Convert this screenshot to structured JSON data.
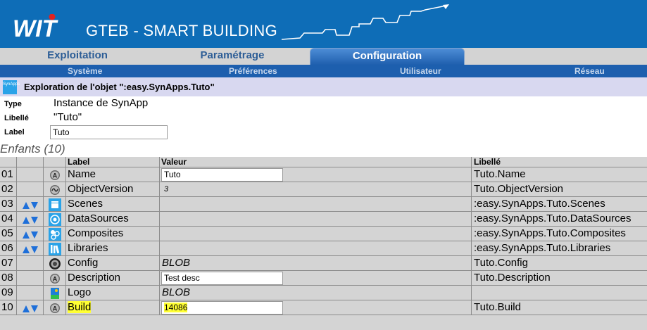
{
  "header": {
    "logo_text": "WIT",
    "app_title": "GTEB - SMART BUILDING",
    "colors": {
      "header_bg": "#0e6db7",
      "logo_red": "#e2221f",
      "accent_blue": "#1d5fae"
    }
  },
  "tabs": [
    {
      "label": "Exploitation",
      "active": false
    },
    {
      "label": "Paramétrage",
      "active": false
    },
    {
      "label": "Configuration",
      "active": true
    }
  ],
  "subtabs": [
    {
      "label": "Système"
    },
    {
      "label": "Préférences"
    },
    {
      "label": "Utilisateur"
    },
    {
      "label": "Réseau"
    }
  ],
  "explorer": {
    "icon_text": "SynApps",
    "title": "Exploration de l'objet \":easy.SynApps.Tuto\"",
    "type_label": "Type",
    "type_value": "Instance de SynApp",
    "libelle_label": "Libellé",
    "libelle_value": "\"Tuto\"",
    "label_label": "Label",
    "label_value": "Tuto"
  },
  "children": {
    "title": "Enfants (10)",
    "columns": {
      "label": "Label",
      "value": "Valeur",
      "libelle": "Libellé"
    },
    "rows": [
      {
        "num": "01",
        "arrows": false,
        "icon": "attribute-icon",
        "label": "Name",
        "value": "Tuto",
        "value_kind": "input",
        "libelle": "Tuto.Name"
      },
      {
        "num": "02",
        "arrows": false,
        "icon": "version-icon",
        "label": "ObjectVersion",
        "value": "3",
        "value_kind": "small",
        "libelle": "Tuto.ObjectVersion"
      },
      {
        "num": "03",
        "arrows": true,
        "icon": "scenes-icon",
        "label": "Scenes",
        "value": "",
        "value_kind": "none",
        "libelle": ":easy.SynApps.Tuto.Scenes"
      },
      {
        "num": "04",
        "arrows": true,
        "icon": "datasources-icon",
        "label": "DataSources",
        "value": "",
        "value_kind": "none",
        "libelle": ":easy.SynApps.Tuto.DataSources"
      },
      {
        "num": "05",
        "arrows": true,
        "icon": "composites-icon",
        "label": "Composites",
        "value": "",
        "value_kind": "none",
        "libelle": ":easy.SynApps.Tuto.Composites"
      },
      {
        "num": "06",
        "arrows": true,
        "icon": "libraries-icon",
        "label": "Libraries",
        "value": "",
        "value_kind": "none",
        "libelle": ":easy.SynApps.Tuto.Libraries"
      },
      {
        "num": "07",
        "arrows": false,
        "icon": "config-icon",
        "label": "Config",
        "value": "BLOB",
        "value_kind": "italic",
        "libelle": "Tuto.Config"
      },
      {
        "num": "08",
        "arrows": false,
        "icon": "attribute-icon",
        "label": "Description",
        "value": "Test desc",
        "value_kind": "input",
        "libelle": "Tuto.Description"
      },
      {
        "num": "09",
        "arrows": false,
        "icon": "logo-image-icon",
        "label": "Logo",
        "value": "BLOB",
        "value_kind": "italic",
        "libelle": ""
      },
      {
        "num": "10",
        "arrows": true,
        "icon": "attribute-icon",
        "label": "Build",
        "value": "14086",
        "value_kind": "input",
        "libelle": "Tuto.Build",
        "highlighted": true
      }
    ]
  }
}
